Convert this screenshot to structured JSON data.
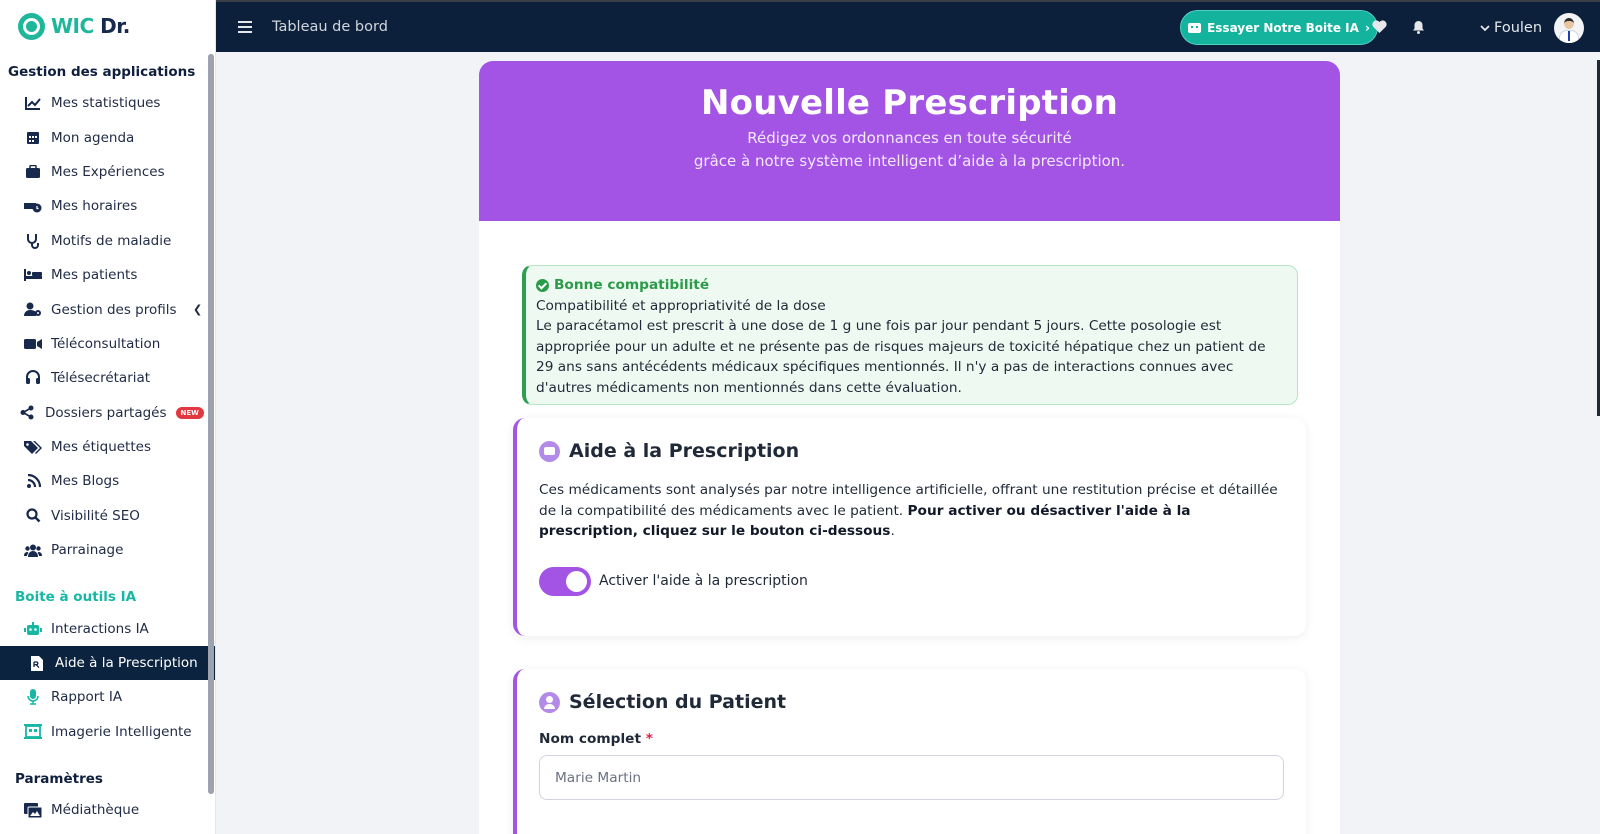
{
  "brand": {
    "wic": "WIC",
    "dr": "Dr."
  },
  "topbar": {
    "title": "Tableau de bord",
    "ai_button": "Essayer Notre Boite IA",
    "ai_arrow": "›",
    "user_name": "Foulen"
  },
  "sidebar": {
    "sections": {
      "apps": "Gestion des applications",
      "ai": "Boite à outils IA",
      "settings": "Paramètres"
    },
    "items": [
      {
        "label": "Mes statistiques",
        "icon": "chart-line-icon"
      },
      {
        "label": "Mon agenda",
        "icon": "calendar-icon"
      },
      {
        "label": "Mes Expériences",
        "icon": "briefcase-icon"
      },
      {
        "label": "Mes horaires",
        "icon": "bed-clock-icon"
      },
      {
        "label": "Motifs de maladie",
        "icon": "stethoscope-icon"
      },
      {
        "label": "Mes patients",
        "icon": "hospital-bed-icon"
      },
      {
        "label": "Gestion des profils",
        "icon": "user-gear-icon"
      },
      {
        "label": "Téléconsultation",
        "icon": "video-icon"
      },
      {
        "label": "Télésecrétariat",
        "icon": "headset-icon"
      },
      {
        "label": "Dossiers partagés",
        "icon": "share-icon",
        "badge": "NEW"
      },
      {
        "label": "Mes étiquettes",
        "icon": "tags-icon"
      },
      {
        "label": "Mes Blogs",
        "icon": "blog-icon"
      },
      {
        "label": "Visibilité SEO",
        "icon": "search-icon"
      },
      {
        "label": "Parrainage",
        "icon": "users-icon"
      }
    ],
    "ai_items": [
      {
        "label": "Interactions IA",
        "icon": "robot-icon"
      },
      {
        "label": "Aide à la Prescription",
        "icon": "prescription-file-icon"
      },
      {
        "label": "Rapport IA",
        "icon": "microphone-icon"
      },
      {
        "label": "Imagerie Intelligente",
        "icon": "building-icon"
      }
    ],
    "settings_items": [
      {
        "label": "Médiathèque",
        "icon": "photo-video-icon"
      }
    ]
  },
  "hero": {
    "title": "Nouvelle Prescription",
    "subtitle_1": "Rédigez vos ordonnances en toute sécurité",
    "subtitle_2": "grâce à notre système intelligent d’aide à la prescription."
  },
  "alert": {
    "title": "Bonne compatibilité",
    "subtitle": "Compatibilité et appropriativité de la dose",
    "body": "Le paracétamol est prescrit à une dose de 1 g une fois par jour pendant 5 jours. Cette posologie est appropriée pour un adulte et ne présente pas de risques majeurs de toxicité hépatique chez un patient de 29 ans sans antécédents médicaux spécifiques mentionnés. Il n'y a pas de interactions connues avec d'autres médicaments non mentionnés dans cette évaluation."
  },
  "prescription_aid": {
    "title": "Aide à la Prescription",
    "text": "Ces médicaments sont analysés par notre intelligence artificielle, offrant une restitution précise et détaillée de la compatibilité des médicaments avec le patient. ",
    "text_bold": "Pour activer ou désactiver l'aide à la prescription, cliquez sur le bouton ci-dessous",
    "text_end": ".",
    "toggle_label": "Activer l'aide à la prescription",
    "toggle_on": true
  },
  "patient": {
    "title": "Sélection du Patient",
    "name_label": "Nom complet",
    "required_mark": "*",
    "name_placeholder": "Marie Martin"
  },
  "colors": {
    "accent": "#a354e4",
    "teal": "#14b39e",
    "navy": "#0c1f3b",
    "success": "#2b9b49"
  }
}
